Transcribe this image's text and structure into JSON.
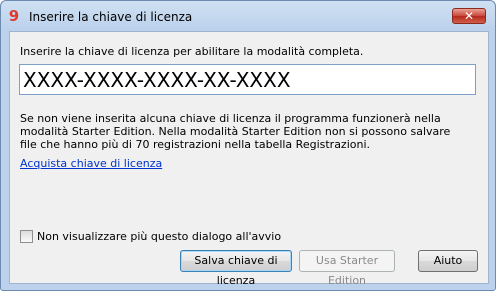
{
  "window": {
    "title": "Inserire la chiave di licenza",
    "close_label": "✕"
  },
  "dialog": {
    "instruction": "Inserire la chiave di licenza per abilitare la modalità completa.",
    "license_key_value": "XXXX-XXXX-XXXX-XX-XXXX",
    "info_text": "Se non viene inserita alcuna chiave di licenza il programma funzionerà nella modalità Starter Edition. Nella modalità Starter Edition non si possono salvare file che hanno più di 70 registrazioni nella tabella Registrazioni.",
    "buy_link": "Acquista chiave di licenza",
    "dont_show_checkbox": {
      "label": "Non visualizzare più questo dialogo all'avvio",
      "checked": false
    }
  },
  "buttons": {
    "save": "Salva chiave di licenza",
    "starter": "Usa Starter Edition",
    "help": "Aiuto"
  },
  "colors": {
    "accent_link": "#0033cc",
    "app_icon": "#e03a2d",
    "close_button": "#c9453a"
  },
  "icons": {
    "app": "app-logo-9-icon",
    "close": "close-icon"
  }
}
